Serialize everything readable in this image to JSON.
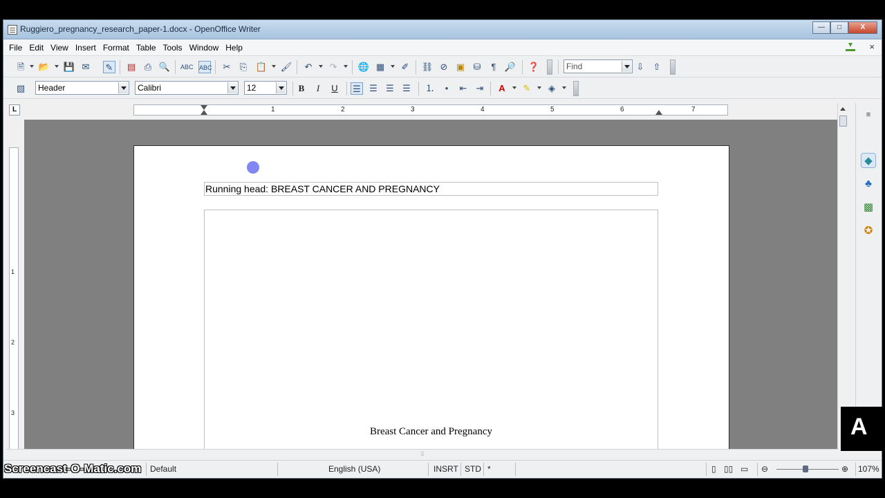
{
  "window": {
    "title": "Ruggiero_pregnancy_research_paper-1.docx - OpenOffice Writer",
    "controls": {
      "minimize": "—",
      "maximize": "□",
      "close": "X"
    }
  },
  "menu": [
    "File",
    "Edit",
    "View",
    "Insert",
    "Format",
    "Table",
    "Tools",
    "Window",
    "Help"
  ],
  "menu_close": "×",
  "toolbar_standard": {
    "find_placeholder": "Find",
    "icons": [
      "new-document-icon",
      "open-icon",
      "save-icon",
      "email-icon",
      "edit-file-icon",
      "export-pdf-icon",
      "print-icon",
      "page-preview-icon",
      "spellcheck-icon",
      "autospellcheck-icon",
      "cut-icon",
      "copy-icon",
      "paste-icon",
      "clone-format-icon",
      "undo-icon",
      "redo-icon",
      "hyperlink-icon",
      "table-icon",
      "draw-icon",
      "find-replace-icon",
      "navigator-icon",
      "gallery-icon",
      "data-sources-icon",
      "nonprinting-chars-icon",
      "zoom-icon",
      "help-icon",
      "find-next-icon",
      "find-previous-icon"
    ]
  },
  "toolbar_formatting": {
    "style": "Header",
    "font": "Calibri",
    "size": "12",
    "bold": "B",
    "italic": "I",
    "underline": "U"
  },
  "ruler": {
    "numbers": [
      "1",
      "2",
      "3",
      "4",
      "5",
      "6",
      "7"
    ],
    "tab_marker": "L"
  },
  "vruler": {
    "numbers": [
      "1",
      "2",
      "3"
    ]
  },
  "document": {
    "header_text": "Running head: BREAST CANCER AND PREGNANCY",
    "title_text": "Breast Cancer and Pregnancy"
  },
  "statusbar": {
    "page_style": "Default",
    "language": "English (USA)",
    "insert_mode": "INSRT",
    "selection_mode": "STD",
    "modified": "*",
    "zoom": "107%"
  },
  "watermark": "Screencast-O-Matic.com",
  "colors": {
    "title_bar": "#b7cfe7",
    "doc_background": "#808080",
    "cursor_highlight": "#6a72f0"
  }
}
